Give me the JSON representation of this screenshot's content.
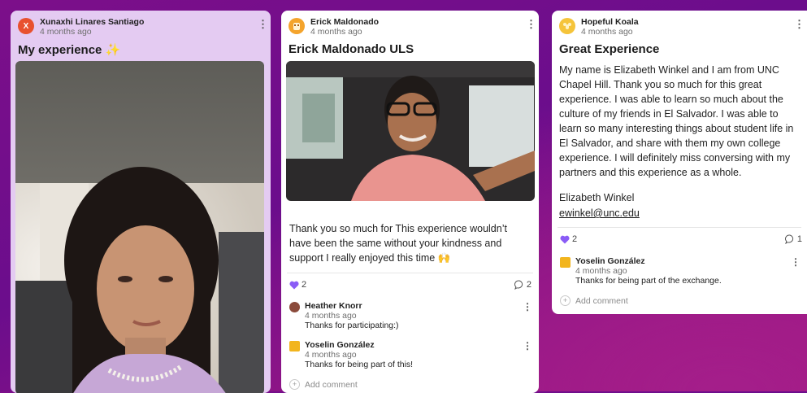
{
  "colors": {
    "accent_heart": "#8a5cf6",
    "card1_bg": "#e4cbf2",
    "page_bg": "#6b0d8c"
  },
  "posts": [
    {
      "author": "Xunaxhi Linares Santiago",
      "avatar_letter": "X",
      "avatar_color": "#e8512f",
      "time": "4 months ago",
      "title": "My experience",
      "title_emoji": "✨"
    },
    {
      "author": "Erick Maldonado",
      "avatar_color": "#f4a42c",
      "time": "4 months ago",
      "title": "Erick Maldonado ULS",
      "body": "Thank you so much for This experience wouldn’t have been the same without your kindness and support  I really enjoyed this time 🙌",
      "likes": "2",
      "comments_count": "2",
      "comments": [
        {
          "author": "Heather Knorr",
          "time": "4 months ago",
          "text": "Thanks for participating:)"
        },
        {
          "author": "Yoselin González",
          "time": "4 months ago",
          "text": "Thanks for being part of this!"
        }
      ],
      "add_comment": "Add comment"
    },
    {
      "author": "Hopeful Koala",
      "avatar_color": "#f5c43a",
      "time": "4 months ago",
      "title": "Great Experience",
      "body": "My name is Elizabeth Winkel and I am from UNC Chapel Hill. Thank you so much for this great experience. I was able to learn so much about the culture of my friends in El Salvador. I was able to learn so many interesting things about student life in El Salvador, and share with them my own college experience. I will definitely miss conversing with my partners and this experience as a whole.",
      "signature": "Elizabeth Winkel",
      "email": "ewinkel@unc.edu",
      "likes": "2",
      "comments_count": "1",
      "comments": [
        {
          "author": "Yoselin González",
          "time": "4 months ago",
          "text": "Thanks for being part of the exchange."
        }
      ],
      "add_comment": "Add comment"
    }
  ]
}
